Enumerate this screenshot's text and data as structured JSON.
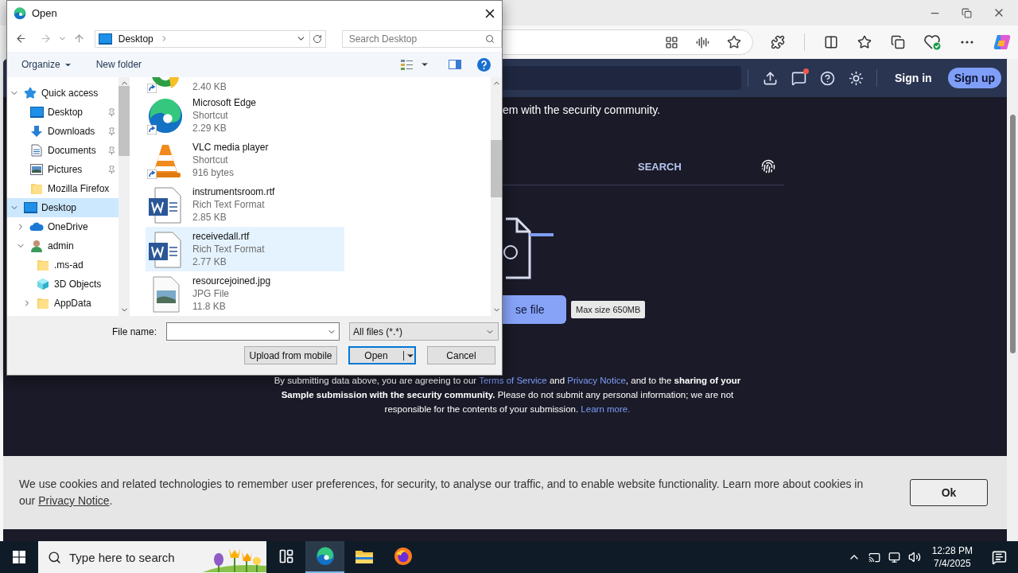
{
  "browser": {
    "page_header": {
      "notification_unread": true,
      "sign_in": "Sign in",
      "sign_up": "Sign up"
    },
    "intro_text": "em with the security community.",
    "search_tab": "SEARCH",
    "upload": {
      "button": "se file",
      "tooltip": "Max size 650MB"
    },
    "disclaimer": [
      {
        "kind": "text",
        "text": "By submitting data above, you are agreeing to our "
      },
      {
        "kind": "link",
        "text": "Terms of Service"
      },
      {
        "kind": "text",
        "text": " and "
      },
      {
        "kind": "link",
        "text": "Privacy Notice"
      },
      {
        "kind": "text",
        "text": ", and to the **sharing of your Sample submission with the security community.** Please do not submit any personal information; we are not responsible for the contents of your submission. "
      },
      {
        "kind": "link",
        "text": "Learn more."
      }
    ],
    "cookie_banner": {
      "text": "We use cookies and related technologies to remember user preferences, for security, to analyse our traffic, and to enable website functionality. Learn more about cookies in our ",
      "link": "Privacy Notice",
      "end": ".",
      "button": "Ok"
    }
  },
  "dialog": {
    "title": "Open",
    "address": "Desktop",
    "search_placeholder": "Search Desktop",
    "toolbar": {
      "organize": "Organize",
      "new_folder": "New folder"
    },
    "tree": [
      {
        "label": "Quick access",
        "kind": "star",
        "expanded": true,
        "selected": false,
        "pinned": false,
        "children": [
          {
            "label": "Desktop",
            "kind": "desktop",
            "selected": false,
            "pinned": true
          },
          {
            "label": "Downloads",
            "kind": "download",
            "selected": false,
            "pinned": true
          },
          {
            "label": "Documents",
            "kind": "document",
            "selected": false,
            "pinned": true
          },
          {
            "label": "Pictures",
            "kind": "pictures",
            "selected": false,
            "pinned": true
          },
          {
            "label": "Mozilla Firefox",
            "kind": "folder",
            "selected": false,
            "pinned": false
          }
        ]
      },
      {
        "label": "Desktop",
        "kind": "desktop",
        "expanded": true,
        "selected": true,
        "pinned": false,
        "children": [
          {
            "label": "OneDrive",
            "kind": "cloud",
            "expanded": false,
            "selected": false,
            "pinned": false
          },
          {
            "label": "admin",
            "kind": "user",
            "expanded": true,
            "selected": false,
            "pinned": false,
            "children": [
              {
                "label": ".ms-ad",
                "kind": "folder",
                "selected": false,
                "pinned": false
              },
              {
                "label": "3D Objects",
                "kind": "cube",
                "selected": false,
                "pinned": false
              },
              {
                "label": "AppData",
                "kind": "folder",
                "expanded": false,
                "selected": false,
                "pinned": false
              }
            ]
          }
        ]
      }
    ],
    "files": [
      {
        "kind": "partial",
        "size": "2.40 KB",
        "shortcut": true,
        "selected": false
      },
      {
        "kind": "edge",
        "name": "Microsoft Edge",
        "type": "Shortcut",
        "size": "2.29 KB",
        "shortcut": true,
        "selected": false
      },
      {
        "kind": "vlc",
        "name": "VLC media player",
        "type": "Shortcut",
        "size": "916 bytes",
        "shortcut": true,
        "selected": false
      },
      {
        "kind": "word",
        "name": "instrumentsroom.rtf",
        "type": "Rich Text Format",
        "size": "2.85 KB",
        "shortcut": false,
        "selected": false
      },
      {
        "kind": "word",
        "name": "receivedall.rtf",
        "type": "Rich Text Format",
        "size": "2.77 KB",
        "shortcut": false,
        "selected": true
      },
      {
        "kind": "image",
        "name": "resourcejoined.jpg",
        "type": "JPG File",
        "size": "11.8 KB",
        "shortcut": false,
        "selected": false
      }
    ],
    "file_name_label": "File name:",
    "file_type": "All files (*.*)",
    "buttons": {
      "upload": "Upload from mobile",
      "open": "Open",
      "cancel": "Cancel"
    }
  },
  "taskbar": {
    "search_placeholder": "Type here to search",
    "apps": [
      {
        "kind": "task-view",
        "selected": false
      },
      {
        "kind": "edge",
        "selected": true
      },
      {
        "kind": "explorer",
        "selected": false
      },
      {
        "kind": "firefox",
        "selected": false
      }
    ],
    "time": "12:28 PM",
    "date": "7/4/2025"
  }
}
